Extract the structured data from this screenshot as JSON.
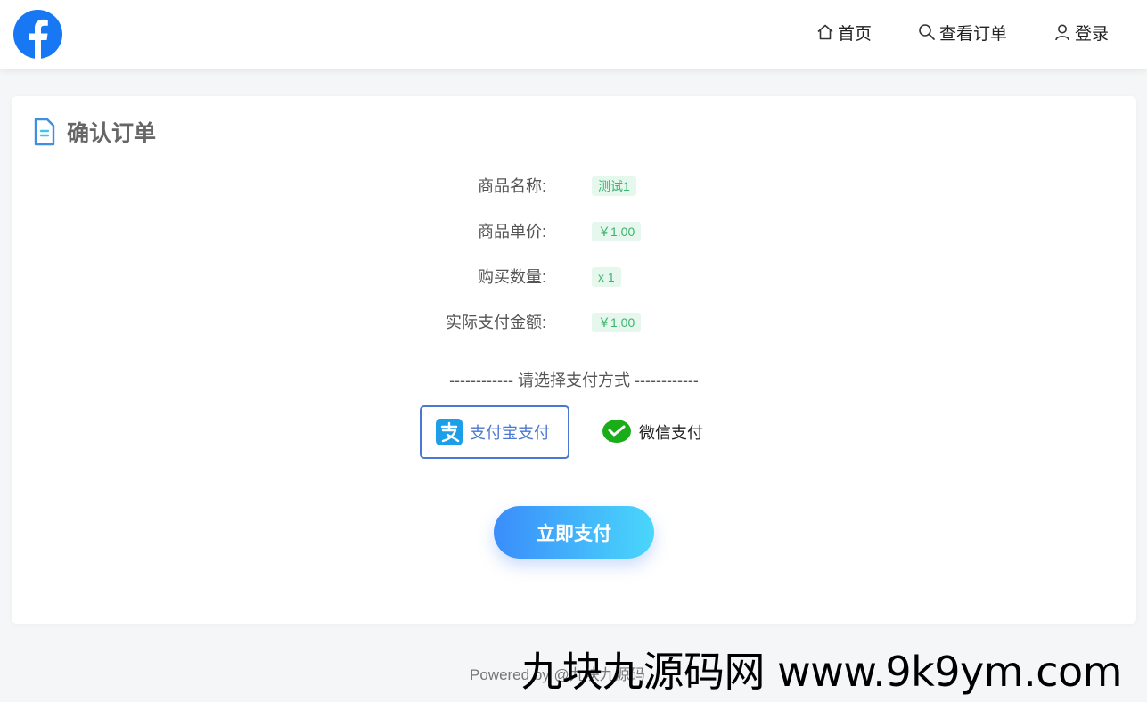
{
  "nav": {
    "home_label": "首页",
    "orders_label": "查看订单",
    "login_label": "登录"
  },
  "card": {
    "title": "确认订单",
    "rows": [
      {
        "label": "商品名称:",
        "value": "测试1"
      },
      {
        "label": "商品单价:",
        "value": "￥1.00"
      },
      {
        "label": "购买数量:",
        "value": "x 1"
      },
      {
        "label": "实际支付金额:",
        "value": "￥1.00"
      }
    ],
    "pay_method_divider": "------------  请选择支付方式  ------------",
    "pay_methods": [
      {
        "label": "支付宝支付",
        "icon": "alipay-icon",
        "selected": true
      },
      {
        "label": "微信支付",
        "icon": "wechat-pay-icon",
        "selected": false
      }
    ],
    "pay_button_label": "立即支付"
  },
  "footer": {
    "text": "Powered by @九块九源码"
  },
  "watermark": {
    "text": "九块九源码网 www.9k9ym.com"
  },
  "colors": {
    "accent": "#4a78d0",
    "tag_bg": "#e6f7ee",
    "tag_text": "#3bb46e",
    "button_gradient_start": "#3a8dfb",
    "button_gradient_end": "#4ad7fb"
  }
}
